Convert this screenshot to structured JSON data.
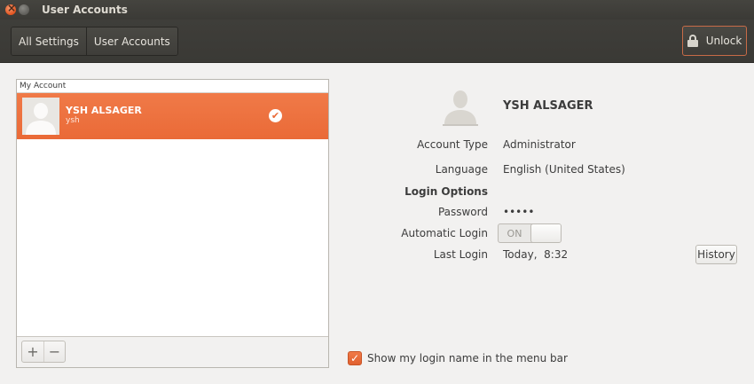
{
  "window": {
    "title": "User Accounts"
  },
  "toolbar": {
    "breadcrumbs": [
      "All Settings",
      "User Accounts"
    ],
    "unlock_label": "Unlock"
  },
  "account_list": {
    "header": "My Account",
    "rows": [
      {
        "name": "YSH ALSAGER",
        "login": "ysh",
        "selected": true,
        "status_icon": "logged-in-check-icon"
      }
    ],
    "add_label": "+",
    "remove_label": "−"
  },
  "details": {
    "full_name": "YSH ALSAGER",
    "account_type_label": "Account Type",
    "account_type": "Administrator",
    "language_label": "Language",
    "language": "English (United States)",
    "login_options_label": "Login Options",
    "password_label": "Password",
    "password": "•••••",
    "auto_login_label": "Automatic Login",
    "auto_login_state": "ON",
    "last_login_label": "Last Login",
    "last_login": "Today,  8:32",
    "history_label": "History"
  },
  "footer": {
    "show_login_name_label": "Show my login name in the menu bar",
    "show_login_name_checked": true
  },
  "colors": {
    "accent": "#ea6a37",
    "toolbar": "#3c3b37",
    "background": "#f2f1f0"
  }
}
